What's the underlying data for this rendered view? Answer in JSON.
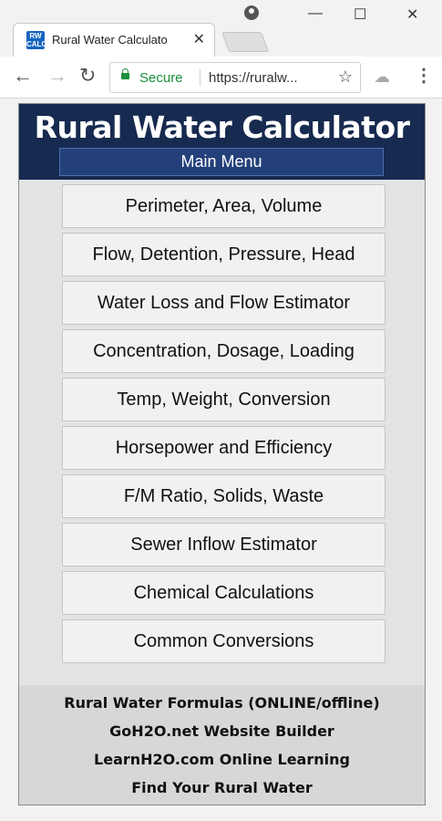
{
  "browser": {
    "tab": {
      "favicon_text": "RW CALC",
      "title": "Rural Water Calculato",
      "close_glyph": "✕"
    },
    "window_controls": {
      "minimize": "—",
      "maximize": "☐",
      "close": "✕"
    },
    "toolbar": {
      "back_glyph": "←",
      "forward_glyph": "→",
      "reload_glyph": "↻",
      "secure_label": "Secure",
      "url": "https://ruralw...",
      "star_glyph": "☆",
      "extension_glyph": "☁",
      "menu_glyph": "⋮"
    }
  },
  "app": {
    "title": "Rural Water Calculator",
    "main_menu_label": "Main Menu",
    "menu_items": [
      "Perimeter, Area, Volume",
      "Flow, Detention, Pressure, Head",
      "Water Loss and Flow Estimator",
      "Concentration, Dosage, Loading",
      "Temp, Weight, Conversion",
      "Horsepower and Efficiency",
      "F/M Ratio, Solids, Waste",
      "Sewer Inflow Estimator",
      "Chemical Calculations",
      "Common Conversions"
    ],
    "footer_links": [
      "Rural Water Formulas (ONLINE/offline)",
      "GoH2O.net Website Builder",
      "LearnH2O.com Online Learning",
      "Find Your Rural Water"
    ]
  },
  "colors": {
    "header_bg": "#172a4f",
    "main_menu_bg": "#23407a",
    "secure_green": "#1a8f3a"
  }
}
